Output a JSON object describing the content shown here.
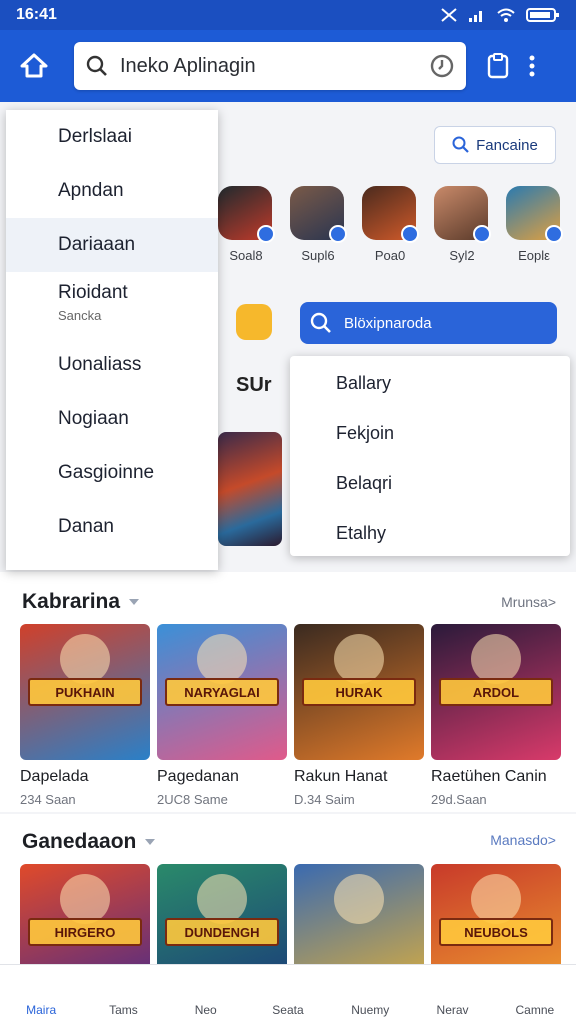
{
  "status": {
    "time": "16:41"
  },
  "search": {
    "text": "Ineko Aplinagin"
  },
  "find_button": {
    "label": "Fancaine"
  },
  "avatars": [
    {
      "label": "Soal8",
      "colors": [
        "#1f2a2e",
        "#c23a2a"
      ]
    },
    {
      "label": "Supl6",
      "colors": [
        "#7a5a48",
        "#2a3550"
      ]
    },
    {
      "label": "Poa0",
      "colors": [
        "#4a2a1e",
        "#d05a2a"
      ]
    },
    {
      "label": "Syl2",
      "colors": [
        "#c98a6a",
        "#5a3a2a"
      ]
    },
    {
      "label": "Eoplε",
      "colors": [
        "#2a7ab0",
        "#e0a040"
      ]
    }
  ],
  "banner": {
    "text": "SUr"
  },
  "drawer": {
    "items": [
      {
        "label": "Derlslaai",
        "icon": "cloud-icon"
      },
      {
        "label": "Apndan",
        "icon": "share-arrow-icon"
      },
      {
        "label": "Dariaaan",
        "icon": "folder-icon",
        "selected": true
      },
      {
        "label": "Rioidant",
        "sub": "Sancka",
        "icon": "open-folder-icon"
      },
      {
        "label": "Uonaliass",
        "icon": "clock-icon"
      },
      {
        "label": "Nogiaan",
        "icon": "wrench-icon"
      },
      {
        "label": "Gasgioinne",
        "icon": "calendar-icon"
      },
      {
        "label": "Danan",
        "icon": "panel-icon"
      }
    ]
  },
  "blue_search": {
    "text": "Blöxipnaroda"
  },
  "popup": {
    "items": [
      {
        "label": "Ballary",
        "icon": "bookmark-icon"
      },
      {
        "label": "Fekjoin",
        "icon": "search-icon",
        "pin": true
      },
      {
        "label": "Belaqri",
        "icon": "columns-icon"
      },
      {
        "label": "Etalhy",
        "icon": "location-icon"
      }
    ]
  },
  "sections": [
    {
      "title": "Kabrarina",
      "more": "Mrunsa>",
      "cards": [
        {
          "title": "Dapelada",
          "sub": "234 Saan",
          "art": "PUKHAIN",
          "bg": [
            "#d0402a",
            "#2a80c8"
          ]
        },
        {
          "title": "Pagedanan",
          "sub": "2UC8 Same",
          "art": "NARYAGLAI",
          "bg": [
            "#3a90d8",
            "#e05a8a"
          ]
        },
        {
          "title": "Rakun Hanat",
          "sub": "D.34 Saim",
          "art": "HURAK",
          "bg": [
            "#3a2a20",
            "#e07a2a"
          ]
        },
        {
          "title": "Raetühen Canin",
          "sub": "29d.Saan",
          "art": "ARDOL",
          "bg": [
            "#2a1a3a",
            "#d83a6a"
          ]
        }
      ]
    },
    {
      "title": "Ganedaaon",
      "more": "Manasdo>",
      "cards": [
        {
          "title": "",
          "sub": "",
          "art": "HIRGERO",
          "bg": [
            "#e04a2a",
            "#4a2a8a"
          ]
        },
        {
          "title": "",
          "sub": "",
          "art": "DUNDENGH",
          "bg": [
            "#2a8a6a",
            "#1a3a7a"
          ]
        },
        {
          "title": "",
          "sub": "",
          "art": "",
          "bg": [
            "#3a6ab0",
            "#e0b03a"
          ]
        },
        {
          "title": "",
          "sub": "",
          "art": "NEUBOLS",
          "bg": [
            "#c83a2a",
            "#f0a030"
          ]
        }
      ]
    }
  ],
  "tabs": [
    {
      "label": "Maira",
      "icon": "home-icon",
      "active": true
    },
    {
      "label": "Tams",
      "icon": "chat-icon"
    },
    {
      "label": "Neo",
      "icon": "book-icon"
    },
    {
      "label": "Seata",
      "icon": "receipt-icon"
    },
    {
      "label": "Nuemy",
      "icon": "smile-icon"
    },
    {
      "label": "Nerav",
      "icon": "profile-badge-icon"
    },
    {
      "label": "Camne",
      "icon": "user-icon"
    }
  ],
  "colors": {
    "primary": "#1d5bd6",
    "accent": "#2a64d9"
  }
}
